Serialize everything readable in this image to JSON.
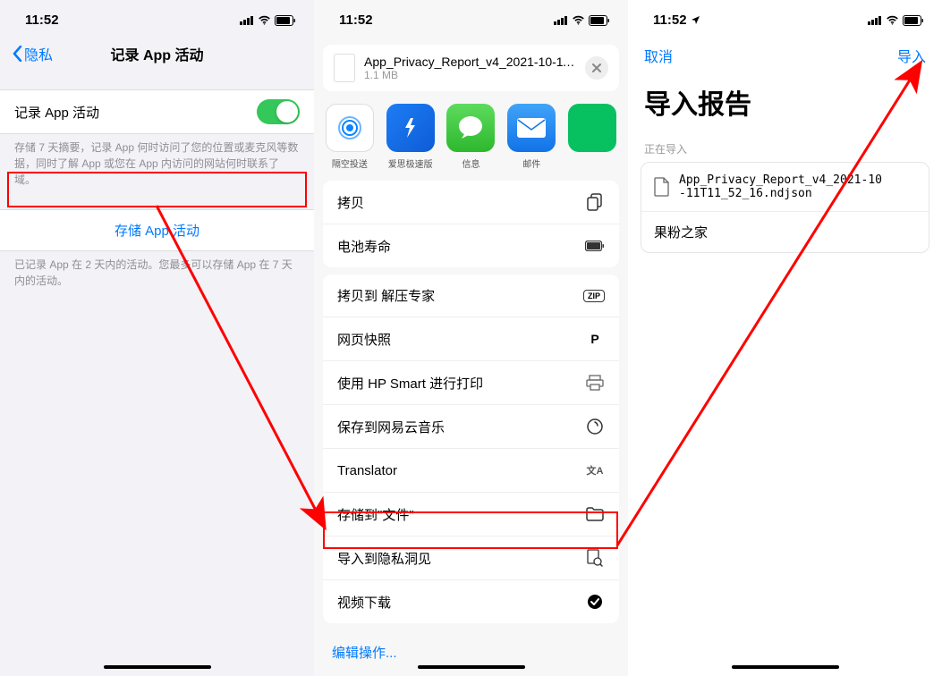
{
  "phone1": {
    "time": "11:52",
    "back": "隐私",
    "title": "记录 App 活动",
    "toggle_label": "记录 App 活动",
    "toggle_footer": "存储 7 天摘要，记录 App 何时访问了您的位置或麦克风等数据，同时了解 App 或您在 App 内访问的网站何时联系了域。",
    "store_button": "存储 App 活动",
    "store_footer": "已记录 App 在 2 天内的活动。您最多可以存储 App 在 7 天内的活动。"
  },
  "phone2": {
    "time": "11:52",
    "file_name": "App_Privacy_Report_v4_2021-10-11T11_...",
    "file_size": "1.1 MB",
    "share": [
      {
        "label": "隔空投送"
      },
      {
        "label": "爱思极速版"
      },
      {
        "label": "信息"
      },
      {
        "label": "邮件"
      }
    ],
    "group1": [
      {
        "label": "拷贝",
        "icon": "copy"
      },
      {
        "label": "电池寿命",
        "icon": "battery"
      }
    ],
    "group2": [
      {
        "label": "拷贝到 解压专家",
        "icon": "zip"
      },
      {
        "label": "网页快照",
        "icon": "p"
      },
      {
        "label": "使用 HP Smart 进行打印",
        "icon": "print"
      },
      {
        "label": "保存到网易云音乐",
        "icon": "music"
      },
      {
        "label": "Translator",
        "icon": "translate"
      },
      {
        "label": "存储到\"文件\"",
        "icon": "folder"
      },
      {
        "label": "导入到隐私洞见",
        "icon": "search"
      },
      {
        "label": "视频下载",
        "icon": "check"
      }
    ],
    "edit": "编辑操作..."
  },
  "phone3": {
    "time": "11:52",
    "cancel": "取消",
    "import": "导入",
    "title": "导入报告",
    "section_label": "正在导入",
    "file_line1": "App_Privacy_Report_v4_2021-10",
    "file_line2": "-11T11_52_16.ndjson",
    "app_name": "果粉之家"
  }
}
